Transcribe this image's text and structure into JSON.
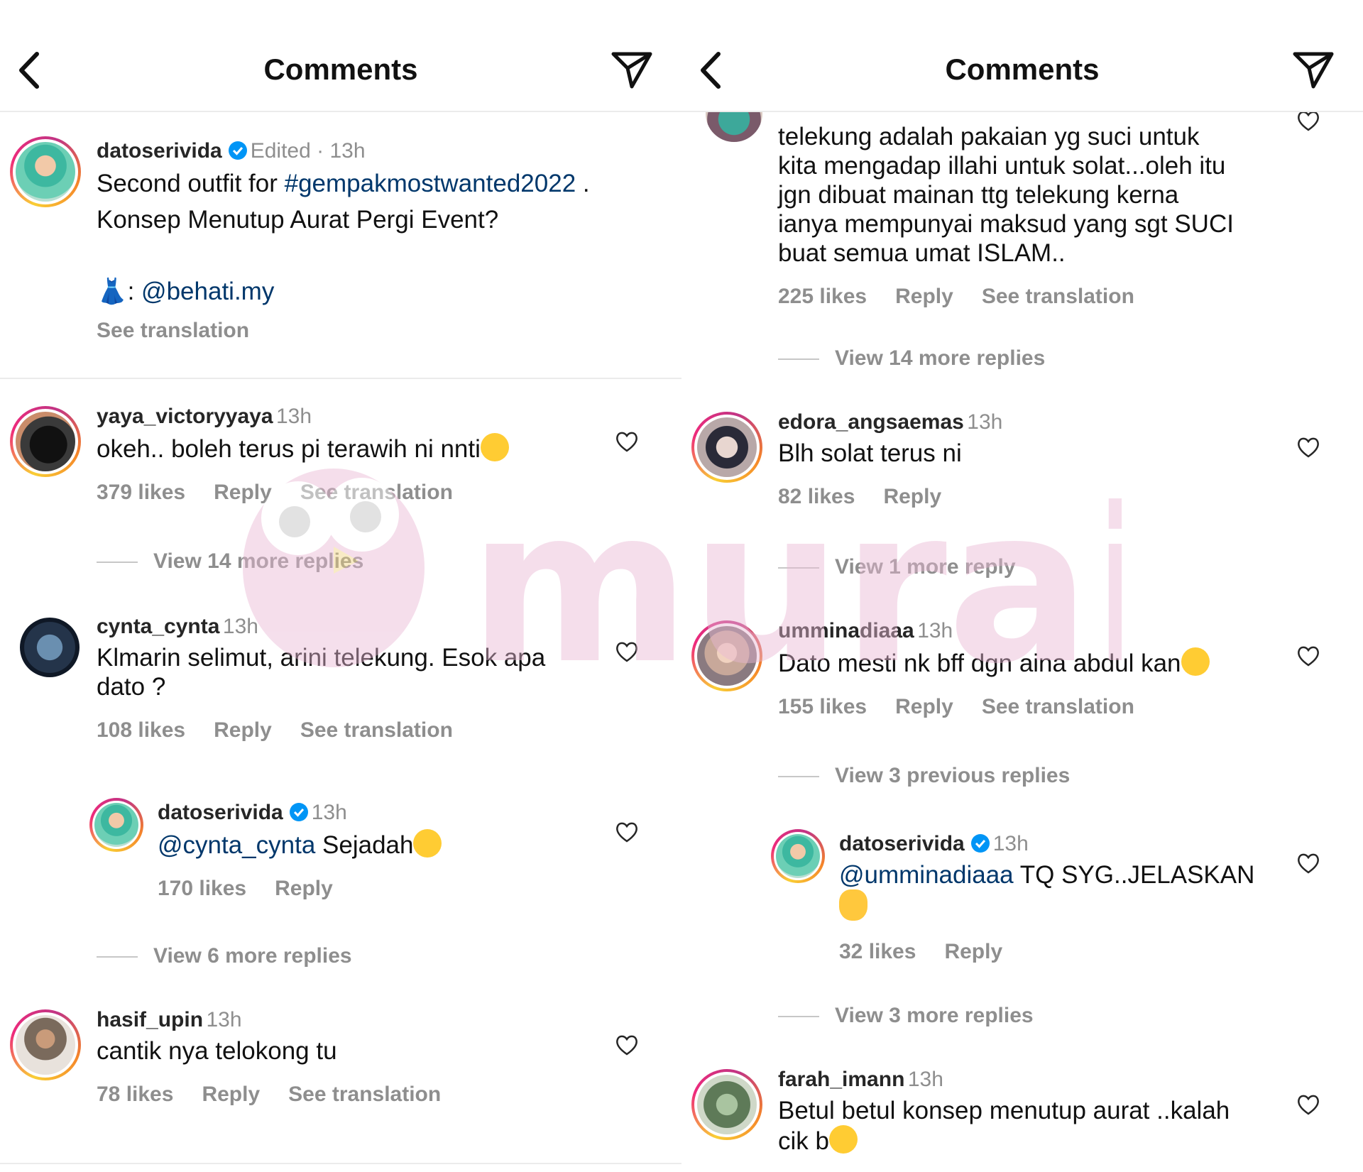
{
  "left": {
    "header": {
      "title": "Comments",
      "back_icon": "chevron-left-icon",
      "send_icon": "paper-plane-icon"
    },
    "caption": {
      "username": "datoserivida",
      "edited": "Edited",
      "dot": " · ",
      "time": "13h",
      "line1_prefix": "Second outfit for ",
      "hashtag": "#gempakmostwanted2022",
      "line1_suffix": " .",
      "line2": "Konsep Menutup Aurat Pergi Event?",
      "dress_emoji": "👗",
      "credit_sep": ": ",
      "credit_mention": "@behati.my",
      "see_translation": "See translation"
    },
    "comments": [
      {
        "username": "yaya_victoryyaya",
        "time": "13h",
        "text": "okeh.. boleh terus pi terawih ni nnti",
        "likes": "379 likes",
        "reply": "Reply",
        "see_translation": "See translation",
        "view_replies": "View 14 more replies"
      },
      {
        "username": "cynta_cynta",
        "time": "13h",
        "text_line1": "Klmarin selimut, arini telekung. Esok apa",
        "text_line2": "dato ?",
        "likes": "108 likes",
        "reply": "Reply",
        "see_translation": "See translation"
      },
      {
        "username": "datoserivida",
        "time": "13h",
        "mention": "@cynta_cynta",
        "text": " Sejadah",
        "likes": "170 likes",
        "reply": "Reply",
        "view_replies": "View 6 more replies"
      },
      {
        "username": "hasif_upin",
        "time": "13h",
        "text": "cantik nya telokong tu",
        "likes": "78 likes",
        "reply": "Reply",
        "see_translation": "See translation"
      }
    ]
  },
  "right": {
    "header": {
      "title": "Comments",
      "back_icon": "chevron-left-icon",
      "send_icon": "paper-plane-icon"
    },
    "partial_comment": {
      "lines": [
        "telekung adalah pakaian yg suci untuk",
        "kita mengadap illahi untuk solat...oleh itu",
        "jgn dibuat mainan ttg telekung kerna",
        "ianya mempunyai maksud yang sgt SUCI",
        "buat semua umat ISLAM.."
      ],
      "likes": "225 likes",
      "reply": "Reply",
      "see_translation": "See translation",
      "view_replies": "View 14 more replies"
    },
    "comments": [
      {
        "username": "edora_angsaemas",
        "time": "13h",
        "text": "Blh solat terus ni",
        "likes": "82 likes",
        "reply": "Reply",
        "view_replies": "View 1 more reply"
      },
      {
        "username": "umminadiaaa",
        "time": "13h",
        "text": "Dato mesti nk bff dgn aina abdul kan",
        "likes": "155 likes",
        "reply": "Reply",
        "see_translation": "See translation",
        "view_replies": "View 3 previous replies"
      },
      {
        "username": "datoserivida",
        "time": "13h",
        "mention": "@umminadiaaa",
        "text": " TQ SYG..JELASKAN",
        "likes": "32 likes",
        "reply": "Reply",
        "view_replies": "View 3 more replies"
      },
      {
        "username": "farah_imann",
        "time": "13h",
        "text_line1": "Betul betul konsep menutup aurat ..kalah",
        "text_line2": "cik b"
      }
    ]
  },
  "watermark": {
    "text": "murai"
  },
  "colors": {
    "link": "#00376b",
    "muted": "#8e8e8e",
    "verified": "#0095f6",
    "watermark": "#e9b8d4"
  }
}
